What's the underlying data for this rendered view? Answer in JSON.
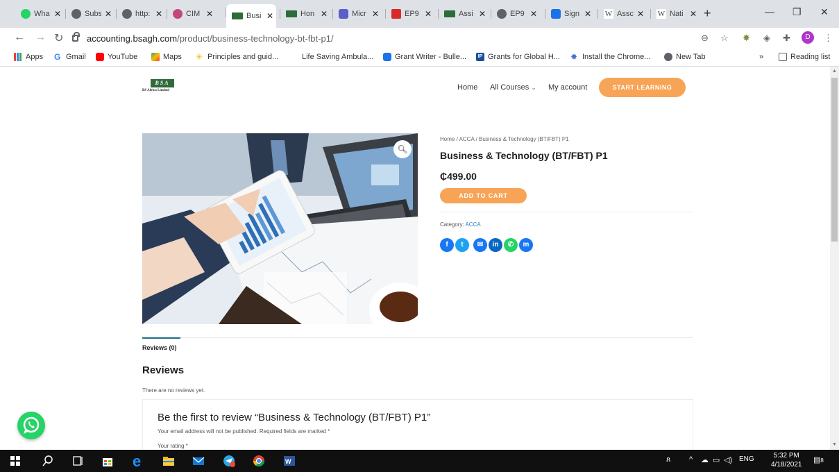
{
  "browser": {
    "tabs": [
      {
        "label": "Wha",
        "color": "#25d366"
      },
      {
        "label": "Subs",
        "color": "#5f6368"
      },
      {
        "label": "http:",
        "color": "#5f6368"
      },
      {
        "label": "CIM",
        "color": "#c2477d"
      },
      {
        "label": "Busi",
        "color": "#2e6b3a",
        "active": true
      },
      {
        "label": "Hon",
        "color": "#2e6b3a"
      },
      {
        "label": "Micr",
        "color": "#5b5fc7"
      },
      {
        "label": "EP9",
        "color": "#d92b2b"
      },
      {
        "label": "Assi",
        "color": "#2e6b3a"
      },
      {
        "label": "EP9",
        "color": "#5f6368"
      },
      {
        "label": "Sign",
        "color": "#1a73e8"
      },
      {
        "label": "Assc",
        "color": "#ffffff"
      },
      {
        "label": "Nati",
        "color": "#ffffff"
      }
    ],
    "url_host": "accounting.bsagh.com",
    "url_path": "/product/business-technology-bt-fbt-p1/",
    "profile_initial": "D",
    "bookmarks": [
      {
        "label": "Apps",
        "icon": "apps-grid-icon"
      },
      {
        "label": "Gmail",
        "icon": "gmail-icon"
      },
      {
        "label": "YouTube",
        "icon": "youtube-icon"
      },
      {
        "label": "Maps",
        "icon": "maps-icon"
      },
      {
        "label": "Principles and guid...",
        "icon": "sun-icon"
      },
      {
        "label": "Life Saving Ambula...",
        "icon": "blank-icon"
      },
      {
        "label": "Grant Writer - Bulle...",
        "icon": "document-icon"
      },
      {
        "label": "Grants for Global H...",
        "icon": "ip-icon"
      },
      {
        "label": "Install the Chrome...",
        "icon": "puzzle-icon"
      },
      {
        "label": "New Tab",
        "icon": "globe-icon"
      }
    ],
    "reading_list": "Reading list",
    "more_bookmarks": "»"
  },
  "site": {
    "logo_mark": "BSA",
    "logo_text": "BS Africa Limited",
    "nav": {
      "home": "Home",
      "courses": "All Courses",
      "courses_chevron": "⌄",
      "account": "My account"
    },
    "cta": "START LEARNING"
  },
  "product": {
    "breadcrumb": "Home / ACCA / Business & Technology (BT/FBT) P1",
    "title": "Business & Technology (BT/FBT) P1",
    "price": "₵499.00",
    "add_to_cart": "ADD TO CART",
    "category_label": "Category:",
    "category_value": "ACCA",
    "share": [
      {
        "name": "facebook-icon",
        "glyph": "f",
        "color": "#1877f2"
      },
      {
        "name": "twitter-icon",
        "glyph": "t",
        "color": "#1da1f2"
      },
      {
        "name": "email-icon",
        "glyph": "✉",
        "color": "#1877f2"
      },
      {
        "name": "linkedin-icon",
        "glyph": "in",
        "color": "#0a66c2"
      },
      {
        "name": "whatsapp-icon",
        "glyph": "✆",
        "color": "#25d366"
      },
      {
        "name": "messenger-icon",
        "glyph": "m",
        "color": "#1877f2"
      }
    ]
  },
  "reviews": {
    "tab_label": "Reviews (0)",
    "heading": "Reviews",
    "empty_text": "There are no reviews yet.",
    "form_title": "Be the first to review “Business & Technology (BT/FBT) P1”",
    "form_note": "Your email address will not be published. Required fields are marked *",
    "rating_label": "Your rating *"
  },
  "taskbar": {
    "language": "ENG",
    "time": "5:32 PM",
    "date": "4/18/2021",
    "notifications": "8"
  }
}
